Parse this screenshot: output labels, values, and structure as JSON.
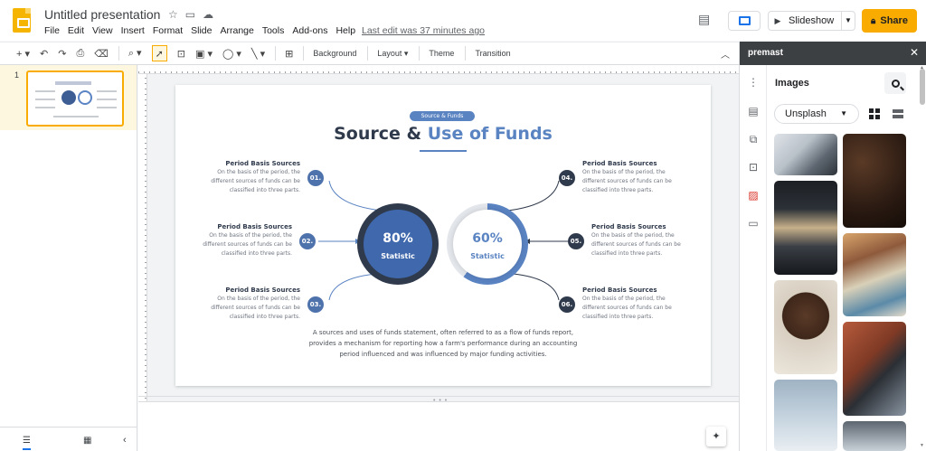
{
  "header": {
    "doc_title": "Untitled presentation",
    "menu": [
      "File",
      "Edit",
      "View",
      "Insert",
      "Format",
      "Slide",
      "Arrange",
      "Tools",
      "Add-ons",
      "Help"
    ],
    "last_edit": "Last edit was 37 minutes ago",
    "slideshow_label": "Slideshow",
    "share_label": "Share",
    "icons": {
      "star": "star-icon",
      "move": "folder-move-icon",
      "cloud": "cloud-status-icon",
      "comment": "comment-icon",
      "present": "present-icon",
      "lock": "lock-icon"
    }
  },
  "toolbar": {
    "background_label": "Background",
    "layout_label": "Layout",
    "theme_label": "Theme",
    "transition_label": "Transition"
  },
  "filmstrip": {
    "slide_number": "1"
  },
  "slide": {
    "pill": "Source & Funds",
    "title_part1": "Source & ",
    "title_part2": "Use of Funds",
    "items": [
      {
        "num": "01.",
        "heading": "Period Basis Sources",
        "line1": "On the basis of the period, the",
        "line2": "different sources of funds can be",
        "line3": "classified into three parts."
      },
      {
        "num": "02.",
        "heading": "Period Basis Sources",
        "line1": "On the basis of the period, the",
        "line2": "different sources of funds can be",
        "line3": "classified into three parts."
      },
      {
        "num": "03.",
        "heading": "Period Basis Sources",
        "line1": "On the basis of the period, the",
        "line2": "different sources of funds can be",
        "line3": "classified into three parts."
      },
      {
        "num": "04.",
        "heading": "Period Basis Sources",
        "line1": "On the basis of the period, the",
        "line2": "different sources of funds can be",
        "line3": "classified into three parts."
      },
      {
        "num": "05.",
        "heading": "Period Basis Sources",
        "line1": "On the basis of the period, the",
        "line2": "different sources of funds can be",
        "line3": "classified into three parts."
      },
      {
        "num": "06.",
        "heading": "Period Basis Sources",
        "line1": "On the basis of the period, the",
        "line2": "different sources of funds can be",
        "line3": "classified into three parts."
      }
    ],
    "stat_left": {
      "value": "80%",
      "label": "Statistic"
    },
    "stat_right": {
      "value": "60%",
      "label": "Statistic"
    },
    "body_line1": "A sources and uses of funds statement, often referred to as a flow of funds report,",
    "body_line2": "provides a mechanism for reporting how a farm's performance during an accounting",
    "body_line3": "period influenced and was influenced by major funding activities.",
    "colors": {
      "dark": "#2f3a4c",
      "accent": "#5a83c2"
    }
  },
  "panel": {
    "addon_name": "premast",
    "title": "Images",
    "source_value": "Unsplash"
  }
}
